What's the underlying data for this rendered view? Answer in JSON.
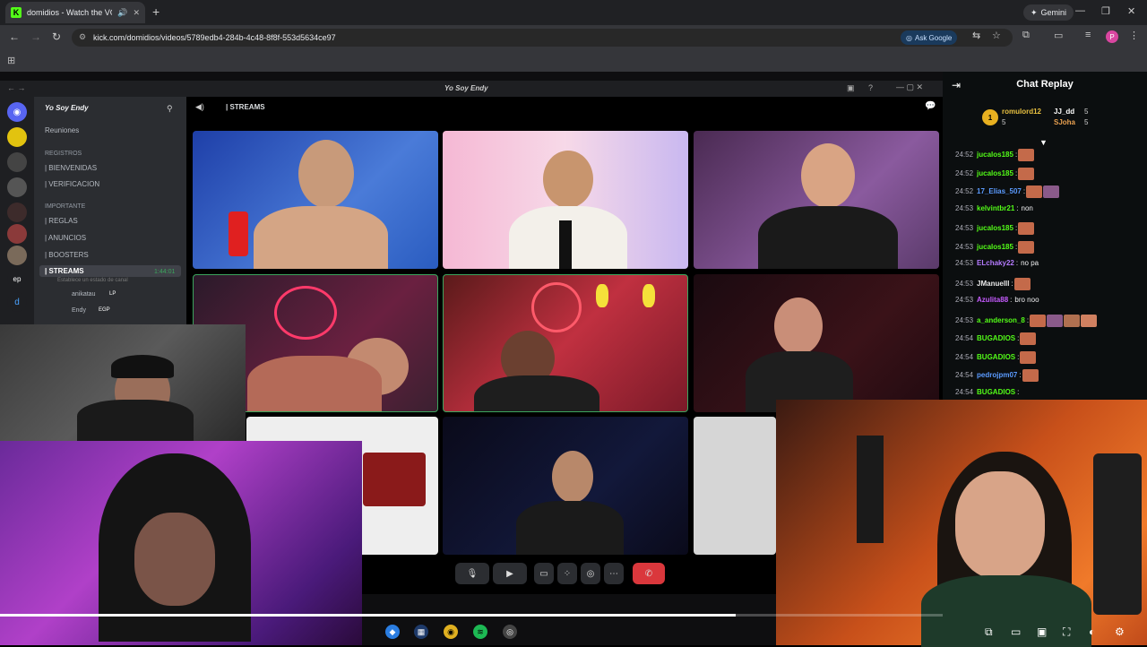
{
  "browser": {
    "tab_title": "domidios - Watch the VOD",
    "tab_favicon": "K",
    "url": "kick.com/domidios/videos/5789edb4-284b-4c48-8f8f-553d5634ce97",
    "gemini_label": "Gemini",
    "ask_google_label": "Ask Google",
    "profile_initial": "P"
  },
  "discord": {
    "window_title": "Yo Soy Endy",
    "server_name": "Yo Soy Endy",
    "reuniones": "Reuniones",
    "channels": [
      {
        "label": "REGISTROS",
        "type": "category"
      },
      {
        "label": "| BIENVENIDAS",
        "type": "text"
      },
      {
        "label": "| VERIFICACION",
        "type": "text"
      },
      {
        "label": "IMPORTANTE",
        "type": "category"
      },
      {
        "label": "| REGLAS",
        "type": "text"
      },
      {
        "label": "| ANUNCIOS",
        "type": "text"
      },
      {
        "label": "| BOOSTERS",
        "type": "text"
      },
      {
        "label": "| STREAMS",
        "type": "voice-active"
      }
    ],
    "stream_timer": "1:44:01",
    "stream_subtitle": "Establece un estado de canal",
    "voice_users": [
      {
        "name": "anikatau",
        "tag": "LP"
      },
      {
        "name": "Endy",
        "tag": "EGP"
      }
    ],
    "stage_header": "| STREAMS",
    "server_icons": [
      "discord-icon",
      "ep",
      "d"
    ]
  },
  "player": {
    "progress_fraction": 0.78
  },
  "chat": {
    "title": "Chat Replay",
    "leaderboard": [
      {
        "rank": "1",
        "name": "romulord12",
        "count": "5"
      },
      {
        "name": "JJ_dd",
        "count": "5"
      },
      {
        "name": "SJoha",
        "count": "5"
      }
    ],
    "messages": [
      {
        "time": "24:52",
        "user": "jucalos185",
        "color": "#53fc18",
        "text": "",
        "emotes": 1
      },
      {
        "time": "24:52",
        "user": "jucalos185",
        "color": "#53fc18",
        "text": "",
        "emotes": 1
      },
      {
        "time": "24:52",
        "user": "17_Elias_507",
        "color": "#5b9bff",
        "text": "",
        "emotes": 2
      },
      {
        "time": "24:53",
        "user": "kelvintbr21",
        "color": "#53fc18",
        "text": "non",
        "emotes": 0
      },
      {
        "time": "24:53",
        "user": "jucalos185",
        "color": "#53fc18",
        "text": "",
        "emotes": 1
      },
      {
        "time": "24:53",
        "user": "jucalos185",
        "color": "#53fc18",
        "text": "",
        "emotes": 1
      },
      {
        "time": "24:53",
        "user": "ELchaky22",
        "color": "#b57bff",
        "text": "no pa",
        "emotes": 0
      },
      {
        "time": "24:53",
        "user": "JManuelll",
        "color": "#e8e8e8",
        "text": "",
        "emotes": 1
      },
      {
        "time": "24:53",
        "user": "Azulita88",
        "color": "#c65bff",
        "text": "bro noo",
        "emotes": 0
      },
      {
        "time": "24:53",
        "user": "a_anderson_8",
        "color": "#53fc18",
        "text": "",
        "emotes": 4
      },
      {
        "time": "24:54",
        "user": "BUGADIOS",
        "color": "#53fc18",
        "text": "",
        "emotes": 1
      },
      {
        "time": "24:54",
        "user": "BUGADIOS",
        "color": "#53fc18",
        "text": "",
        "emotes": 1
      },
      {
        "time": "24:54",
        "user": "pedrojpm07",
        "color": "#5b9bff",
        "text": "",
        "emotes": 1
      },
      {
        "time": "24:54",
        "user": "BUGADIOS",
        "color": "#53fc18",
        "text": "",
        "emotes": 0
      }
    ]
  }
}
